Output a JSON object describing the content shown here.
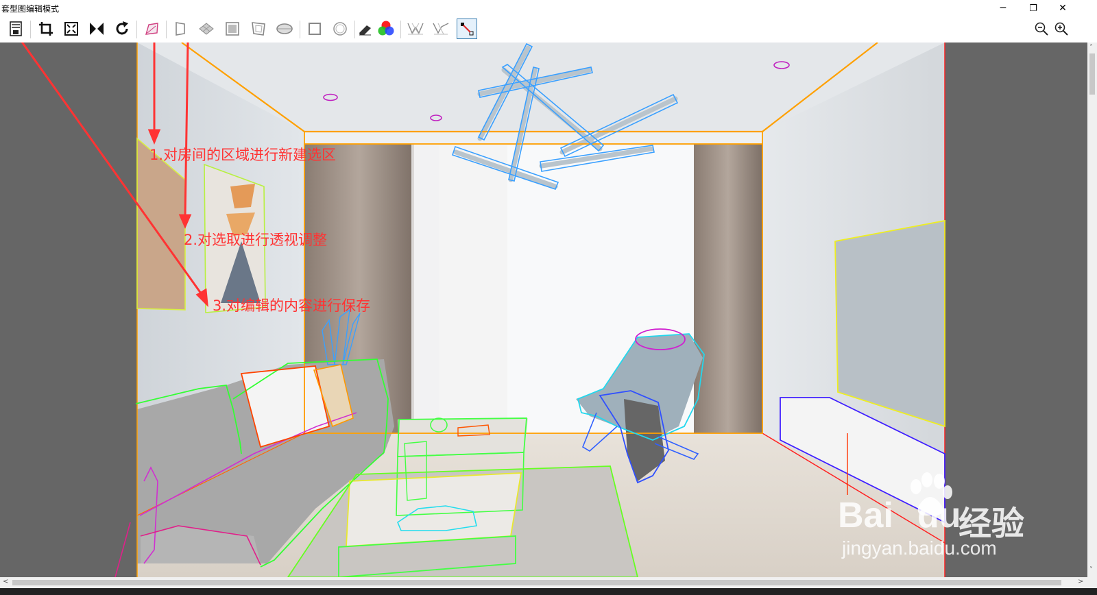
{
  "window": {
    "title": "套型图编辑模式",
    "minimize_glyph": "─",
    "restore_glyph": "❐",
    "close_glyph": "✕"
  },
  "toolbar": {
    "tools": [
      {
        "name": "save-icon"
      },
      {
        "name": "crop-icon"
      },
      {
        "name": "fit-view-icon"
      },
      {
        "name": "flip-horizontal-icon"
      },
      {
        "name": "rotate-icon"
      },
      {
        "name": "new-selection-icon"
      },
      {
        "name": "perspective-icon"
      },
      {
        "name": "grid-warp-icon"
      },
      {
        "name": "rect-frame-icon"
      },
      {
        "name": "distort-icon"
      },
      {
        "name": "ellipse-icon"
      },
      {
        "name": "square-icon"
      },
      {
        "name": "circle-icon"
      },
      {
        "name": "eraser-icon"
      },
      {
        "name": "color-wheel-icon"
      },
      {
        "name": "mesh-edit-icon"
      },
      {
        "name": "mesh-adjust-icon"
      },
      {
        "name": "point-connect-icon",
        "active": true
      }
    ],
    "zoom_out": "zoom-out-icon",
    "zoom_in": "zoom-in-icon"
  },
  "annotations": [
    "1.对房间的区域进行新建选区",
    "2.对选取进行透视调整",
    "3.对编辑的内容进行保存"
  ],
  "watermark": {
    "brand": "Bai",
    "brand2": "du",
    "cn": "经验",
    "url": "jingyan.baidu.com"
  },
  "colors": {
    "annotation": "#ff3333",
    "selection_orange": "#ffa000",
    "selection_green": "#33ff33",
    "selection_blue": "#3aa0ff",
    "selection_magenta": "#e020c0",
    "selection_yellow": "#eeee22",
    "selection_red": "#ff2222"
  },
  "scroll": {
    "left_arrow": "<",
    "right_arrow": ">",
    "up_arrow": "˄",
    "down_arrow": "˅"
  }
}
